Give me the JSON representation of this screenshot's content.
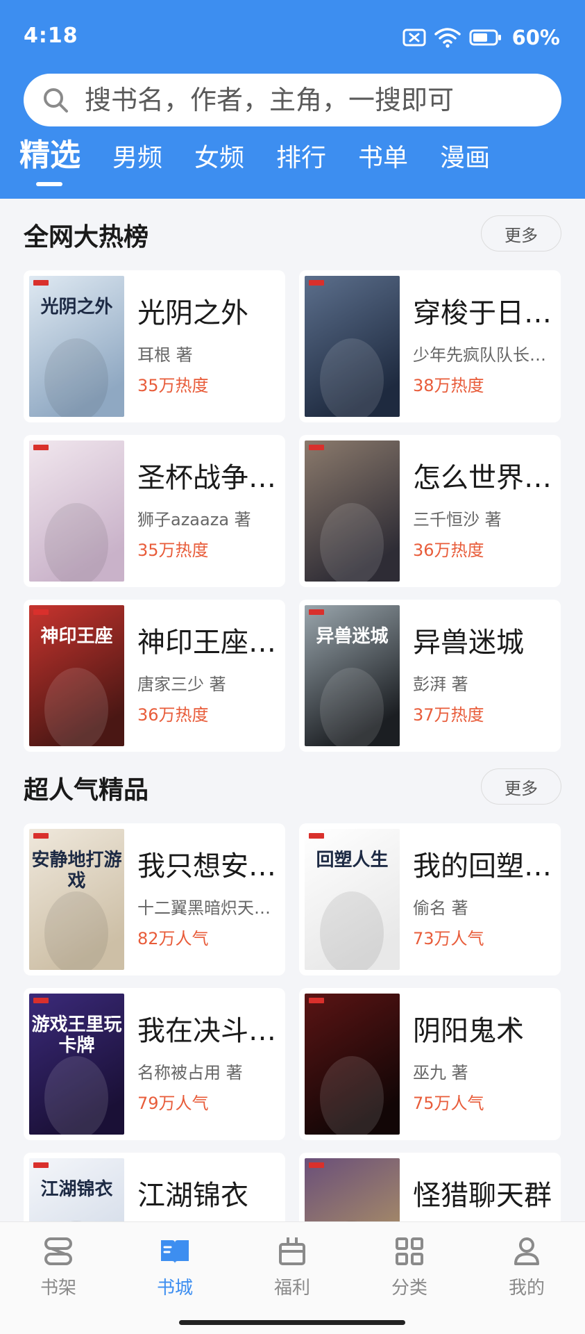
{
  "status": {
    "time": "4:18",
    "battery": "60%"
  },
  "search": {
    "placeholder": "搜书名，作者，主角，一搜即可"
  },
  "tabs": [
    "精选",
    "男频",
    "女频",
    "排行",
    "书单",
    "漫画"
  ],
  "sections": [
    {
      "title": "全网大热榜",
      "more": "更多",
      "books": [
        {
          "title": "光阴之外",
          "author": "耳根  著",
          "heat": "35万热度",
          "cover_text": "光阴之外",
          "cover_colors": [
            "#dfe9f2",
            "#8fa8c2"
          ]
        },
        {
          "title": "穿梭于日…",
          "author": "少年先疯队队长…",
          "heat": "38万热度",
          "cover_text": "",
          "cover_colors": [
            "#5c6f8c",
            "#1e2a3f"
          ]
        },
        {
          "title": "圣杯战争…",
          "author": "狮子azaaza 著",
          "heat": "35万热度",
          "cover_text": "",
          "cover_colors": [
            "#f1e7ee",
            "#c9b2c9"
          ]
        },
        {
          "title": "怎么世界…",
          "author": "三千恒沙 著",
          "heat": "36万热度",
          "cover_text": "",
          "cover_colors": [
            "#8b7a6c",
            "#2e2c35"
          ]
        },
        {
          "title": "神印王座…",
          "author": "唐家三少 著",
          "heat": "36万热度",
          "cover_text": "神印王座",
          "cover_colors": [
            "#c7342e",
            "#4a1714"
          ]
        },
        {
          "title": "异兽迷城",
          "author": "彭湃 著",
          "heat": "37万热度",
          "cover_text": "异兽迷城",
          "cover_colors": [
            "#9aa6ad",
            "#1b1e22"
          ]
        }
      ]
    },
    {
      "title": "超人气精品",
      "more": "更多",
      "books": [
        {
          "title": "我只想安…",
          "author": "十二翼黑暗炽天…",
          "heat": "82万人气",
          "cover_text": "安静地打游戏",
          "cover_colors": [
            "#efe8dc",
            "#cdbfa6"
          ]
        },
        {
          "title": "我的回塑…",
          "author": "偷名 著",
          "heat": "73万人气",
          "cover_text": "回塑人生",
          "cover_colors": [
            "#ffffff",
            "#e8e8e8"
          ]
        },
        {
          "title": "我在决斗…",
          "author": "名称被占用 著",
          "heat": "79万人气",
          "cover_text": "游戏王里玩卡牌",
          "cover_colors": [
            "#3b2a7a",
            "#1a1036"
          ]
        },
        {
          "title": "阴阳鬼术",
          "author": "巫九 著",
          "heat": "75万人气",
          "cover_text": "",
          "cover_colors": [
            "#5a1414",
            "#120606"
          ]
        },
        {
          "title": "江湖锦衣",
          "author": "",
          "heat": "",
          "cover_text": "江湖锦衣",
          "cover_colors": [
            "#f4f6fa",
            "#cfd8e6"
          ]
        },
        {
          "title": "怪猎聊天群",
          "author": "",
          "heat": "",
          "cover_text": "",
          "cover_colors": [
            "#6a4f7a",
            "#b59a63"
          ]
        }
      ]
    }
  ],
  "bottom_nav": [
    {
      "label": "书架",
      "icon": "bookshelf-icon"
    },
    {
      "label": "书城",
      "icon": "open-book-icon"
    },
    {
      "label": "福利",
      "icon": "gift-icon"
    },
    {
      "label": "分类",
      "icon": "grid-icon"
    },
    {
      "label": "我的",
      "icon": "person-icon"
    }
  ],
  "colors": {
    "accent": "#3d8ef0",
    "heat": "#e85c3a"
  }
}
